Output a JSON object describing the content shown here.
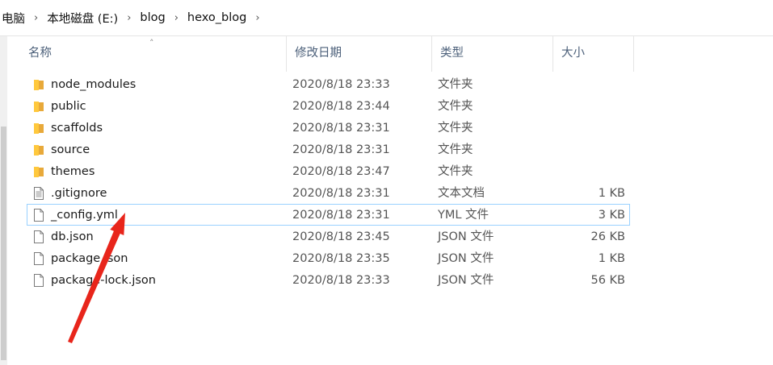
{
  "breadcrumb": [
    {
      "label": "电脑"
    },
    {
      "label": "本地磁盘 (E:)"
    },
    {
      "label": "blog"
    },
    {
      "label": "hexo_blog"
    }
  ],
  "columns": {
    "name": "名称",
    "date": "修改日期",
    "type": "类型",
    "size": "大小"
  },
  "files": [
    {
      "name": "node_modules",
      "date": "2020/8/18 23:33",
      "type": "文件夹",
      "size": "",
      "icon": "folder-icon"
    },
    {
      "name": "public",
      "date": "2020/8/18 23:44",
      "type": "文件夹",
      "size": "",
      "icon": "folder-icon"
    },
    {
      "name": "scaffolds",
      "date": "2020/8/18 23:31",
      "type": "文件夹",
      "size": "",
      "icon": "folder-icon"
    },
    {
      "name": "source",
      "date": "2020/8/18 23:31",
      "type": "文件夹",
      "size": "",
      "icon": "folder-icon"
    },
    {
      "name": "themes",
      "date": "2020/8/18 23:47",
      "type": "文件夹",
      "size": "",
      "icon": "folder-icon"
    },
    {
      "name": ".gitignore",
      "date": "2020/8/18 23:31",
      "type": "文本文档",
      "size": "1 KB",
      "icon": "text-file-icon"
    },
    {
      "name": "_config.yml",
      "date": "2020/8/18 23:31",
      "type": "YML 文件",
      "size": "3 KB",
      "icon": "file-icon",
      "selected": true
    },
    {
      "name": "db.json",
      "date": "2020/8/18 23:45",
      "type": "JSON 文件",
      "size": "26 KB",
      "icon": "file-icon"
    },
    {
      "name": "package.json",
      "date": "2020/8/18 23:35",
      "type": "JSON 文件",
      "size": "1 KB",
      "icon": "file-icon"
    },
    {
      "name": "package-lock.json",
      "date": "2020/8/18 23:33",
      "type": "JSON 文件",
      "size": "56 KB",
      "icon": "file-icon"
    }
  ],
  "colors": {
    "folder": "#ffc83d",
    "selection_border": "#99d1ff",
    "annotation_arrow": "#e8251b"
  }
}
